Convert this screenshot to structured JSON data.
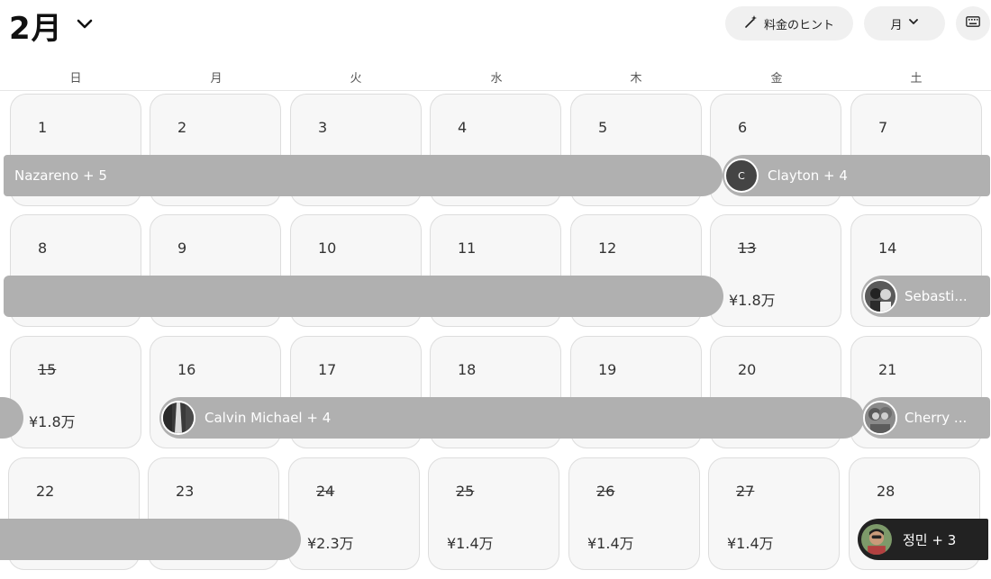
{
  "header": {
    "month_label": "2月",
    "pricing_hint_label": "料金のヒント",
    "view_mode_label": "月"
  },
  "weekdays": [
    "日",
    "月",
    "火",
    "水",
    "木",
    "金",
    "土"
  ],
  "days": [
    {
      "num": "1"
    },
    {
      "num": "2"
    },
    {
      "num": "3"
    },
    {
      "num": "4"
    },
    {
      "num": "5"
    },
    {
      "num": "6"
    },
    {
      "num": "7"
    },
    {
      "num": "8"
    },
    {
      "num": "9"
    },
    {
      "num": "10"
    },
    {
      "num": "11"
    },
    {
      "num": "12"
    },
    {
      "num": "13",
      "struck": true,
      "price": "¥1.8万"
    },
    {
      "num": "14"
    },
    {
      "num": "15",
      "struck": true,
      "price": "¥1.8万"
    },
    {
      "num": "16"
    },
    {
      "num": "17"
    },
    {
      "num": "18"
    },
    {
      "num": "19"
    },
    {
      "num": "20"
    },
    {
      "num": "21"
    },
    {
      "num": "22"
    },
    {
      "num": "23"
    },
    {
      "num": "24",
      "struck": true,
      "price": "¥2.3万"
    },
    {
      "num": "25",
      "struck": true,
      "price": "¥1.4万"
    },
    {
      "num": "26",
      "struck": true,
      "price": "¥1.4万"
    },
    {
      "num": "27",
      "struck": true,
      "price": "¥1.4万"
    },
    {
      "num": "28"
    }
  ],
  "reservations": {
    "nazareno": {
      "label": "Nazareno + 5"
    },
    "clayton": {
      "label": "Clayton + 4",
      "initial": "C"
    },
    "sebastian": {
      "label": "Sebasti..."
    },
    "calvin": {
      "label": "Calvin Michael + 4"
    },
    "cherry": {
      "label": "Cherry ..."
    },
    "jeongmin": {
      "label": "정민 + 3"
    }
  },
  "colors": {
    "bar": "#b0b0b0",
    "bar_active": "#222222",
    "cell_bg": "#f7f7f7"
  }
}
